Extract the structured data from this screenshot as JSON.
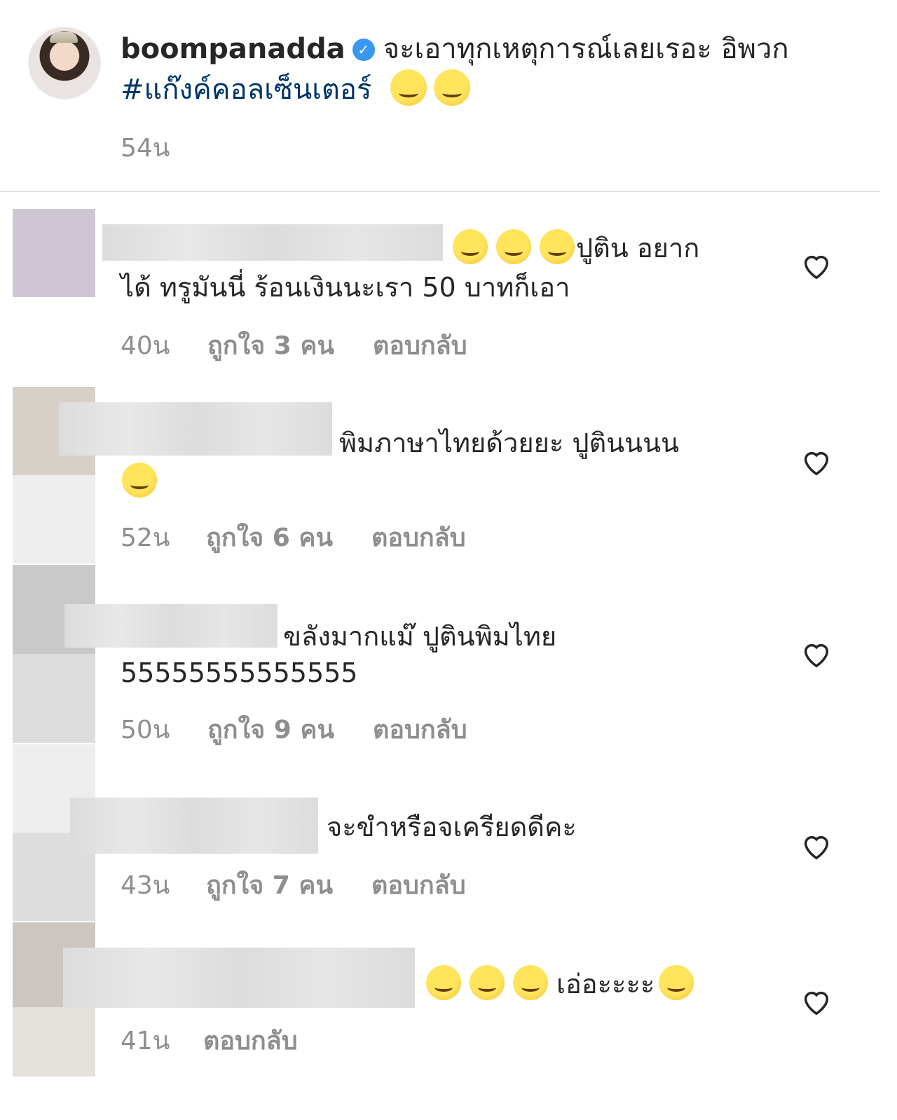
{
  "caption": {
    "username": "boompanadda",
    "text": "จะเอาทุกเหตุการณ์เลยเรอะ อิพวก",
    "hashtag": "#แก๊งค์คอลเซ็นเตอร์",
    "time": "54น"
  },
  "comments": [
    {
      "text_line1": "ปูติน อยาก",
      "text_line2": "ได้ ทรูมันนี่ ร้อนเงินนะเรา 50 บาทก็เอา",
      "time": "40น",
      "likes": "ถูกใจ 3 คน",
      "reply": "ตอบกลับ"
    },
    {
      "text_line1": "พิมภาษาไทยด้วยยะ ปูตินนนน",
      "time": "52น",
      "likes": "ถูกใจ 6 คน",
      "reply": "ตอบกลับ"
    },
    {
      "text_line1": "ขลังมากแม๊ ปูตินพิมไทย",
      "text_line2": "55555555555555",
      "time": "50น",
      "likes": "ถูกใจ 9 คน",
      "reply": "ตอบกลับ"
    },
    {
      "text_line1": "จะขำหรือจเครียดดีคะ",
      "time": "43น",
      "likes": "ถูกใจ 7 คน",
      "reply": "ตอบกลับ"
    },
    {
      "text_line1": "เอ่อะะะะ",
      "time": "41น",
      "reply": "ตอบกลับ"
    }
  ],
  "icons": {
    "verified": "verified-badge-icon",
    "like": "heart-icon"
  },
  "colors": {
    "hashtag": "#003569",
    "meta": "#8e8e8e",
    "verified": "#3897f0"
  }
}
